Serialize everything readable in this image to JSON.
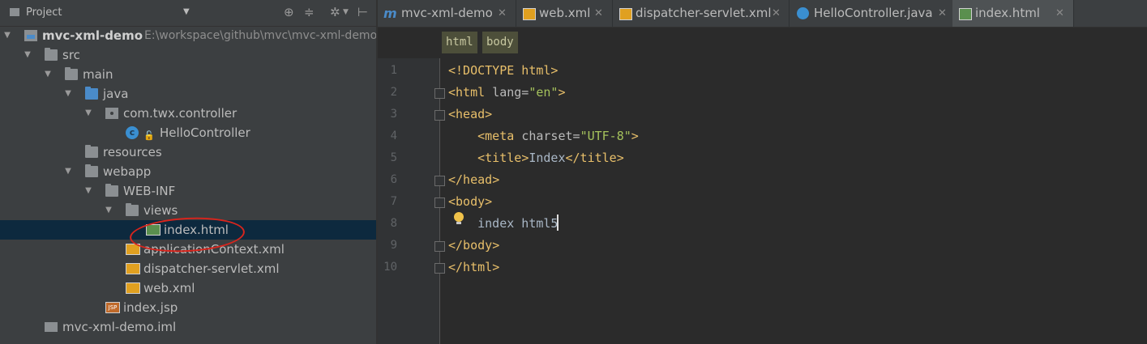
{
  "project_panel": {
    "title": "Project",
    "tree": [
      {
        "label": "mvc-xml-demo",
        "path": "E:\\workspace\\github\\mvc\\mvc-xml-demo",
        "depth": 0,
        "icon": "project-folder-icon",
        "expanded": true
      },
      {
        "label": "src",
        "depth": 1,
        "icon": "folder-icon",
        "expanded": true
      },
      {
        "label": "main",
        "depth": 2,
        "icon": "folder-icon",
        "expanded": true
      },
      {
        "label": "java",
        "depth": 3,
        "icon": "source-folder-icon",
        "expanded": true
      },
      {
        "label": "com.twx.controller",
        "depth": 4,
        "icon": "package-icon",
        "expanded": true
      },
      {
        "label": "HelloController",
        "depth": 5,
        "icon": "class-icon"
      },
      {
        "label": "resources",
        "depth": 3,
        "icon": "resources-folder-icon"
      },
      {
        "label": "webapp",
        "depth": 3,
        "icon": "web-folder-icon",
        "expanded": true
      },
      {
        "label": "WEB-INF",
        "depth": 4,
        "icon": "folder-icon",
        "expanded": true
      },
      {
        "label": "views",
        "depth": 5,
        "icon": "folder-icon",
        "expanded": true
      },
      {
        "label": "index.html",
        "depth": 6,
        "icon": "html-file-icon",
        "selected": true
      },
      {
        "label": "applicationContext.xml",
        "depth": 5,
        "icon": "xml-file-icon"
      },
      {
        "label": "dispatcher-servlet.xml",
        "depth": 5,
        "icon": "xml-file-icon"
      },
      {
        "label": "web.xml",
        "depth": 5,
        "icon": "xml-file-icon"
      },
      {
        "label": "index.jsp",
        "depth": 4,
        "icon": "jsp-file-icon"
      },
      {
        "label": "mvc-xml-demo.iml",
        "depth": 1,
        "icon": "iml-file-icon"
      }
    ]
  },
  "tabs": [
    {
      "label": "mvc-xml-demo",
      "icon": "maven-icon",
      "active": false
    },
    {
      "label": "web.xml",
      "icon": "xml-file-icon",
      "active": false
    },
    {
      "label": "dispatcher-servlet.xml",
      "icon": "xml-file-icon",
      "active": false
    },
    {
      "label": "HelloController.java",
      "icon": "class-icon",
      "active": false
    },
    {
      "label": "index.html",
      "icon": "html-file-icon",
      "active": true
    }
  ],
  "breadcrumbs": [
    "html",
    "body"
  ],
  "editor": {
    "line_numbers": [
      "1",
      "2",
      "3",
      "4",
      "5",
      "6",
      "7",
      "8",
      "9",
      "10"
    ],
    "lines": [
      "<!DOCTYPE html>",
      "<html lang=\"en\">",
      "<head>",
      "    <meta charset=\"UTF-8\">",
      "    <title>Index</title>",
      "</head>",
      "<body>",
      "    index html5",
      "</body>",
      "</html>"
    ]
  },
  "colors": {
    "tag": "#e8bf6a",
    "attribute_value": "#a5c25c",
    "selection": "#0d293e",
    "annotation_circle": "#d8251d"
  }
}
